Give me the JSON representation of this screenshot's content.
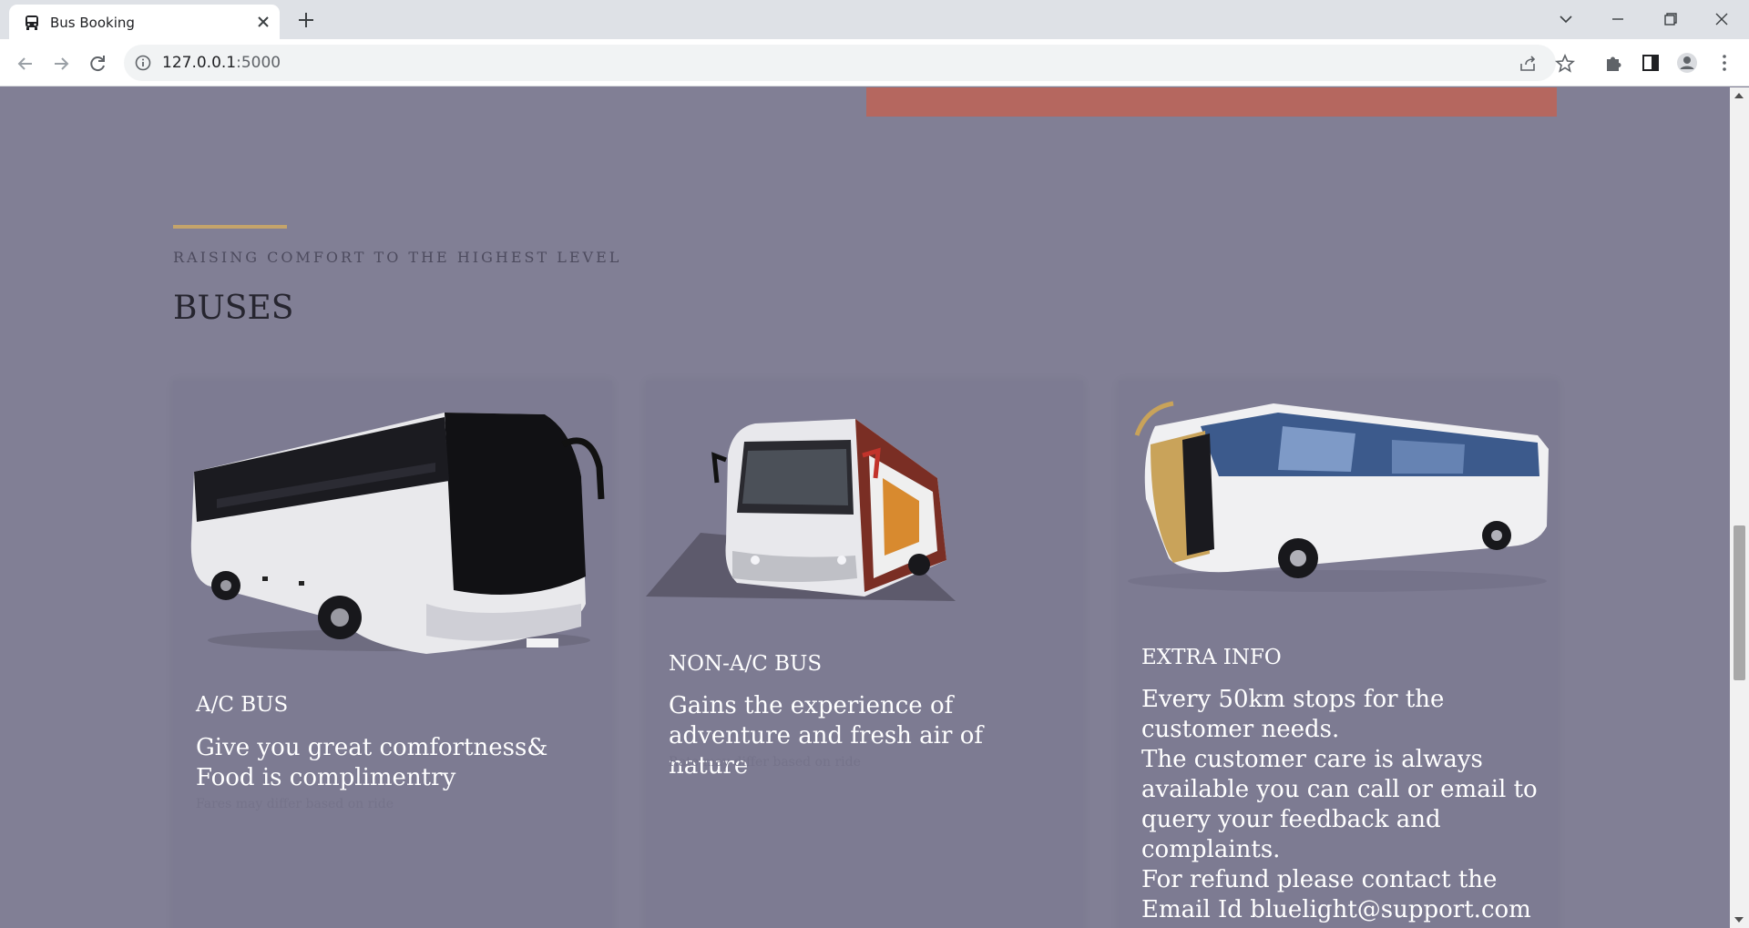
{
  "browser": {
    "tab_title": "Bus Booking",
    "url_host": "127.0.0.1",
    "url_port": ":5000"
  },
  "page": {
    "section": {
      "subtitle": "RAISING COMFORT TO THE HIGHEST LEVEL",
      "title": "BUSES"
    },
    "cards": [
      {
        "title": "A/C BUS",
        "description": "Give you great comfortness& Food is complimentry",
        "note": "Fares may differ based on ride"
      },
      {
        "title": "NON-A/C BUS",
        "description": "Gains the experience of adventure and fresh air of nature",
        "note": "Rate may differ based on ride"
      },
      {
        "title": "EXTRA INFO",
        "lines": [
          "Every 50km stops for the customer needs.",
          "The customer care is always available you can call or email to query your feedback and complaints.",
          "For refund please contact the Email Id bluelight@support.com"
        ]
      }
    ]
  },
  "colors": {
    "page_bg": "#817f95",
    "accent_line": "#c4a46b",
    "banner_red": "#b5675f"
  }
}
